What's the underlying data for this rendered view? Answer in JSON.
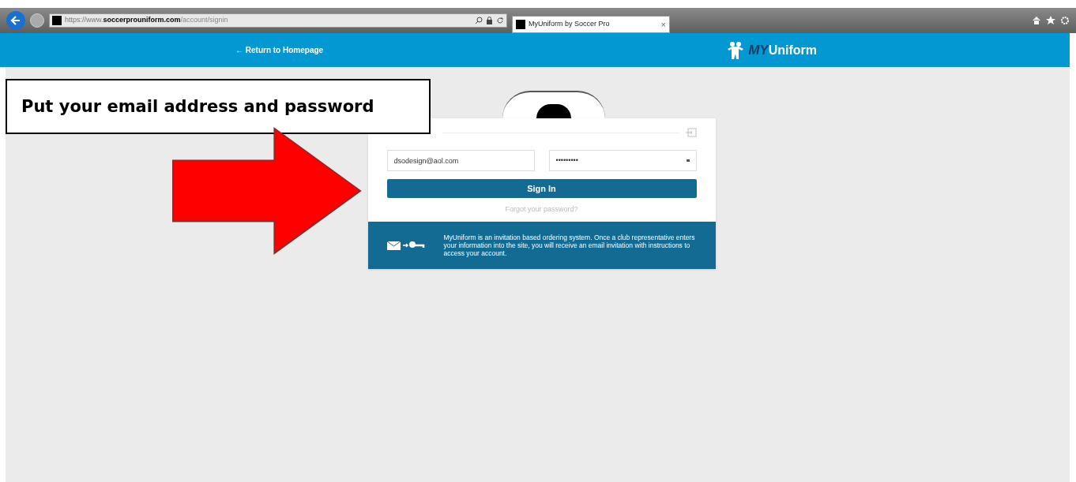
{
  "browser": {
    "url": {
      "scheme": "https://www.",
      "domain": "soccerprouniform.com",
      "path": "/account/signin"
    },
    "tab_title": "MyUniform by Soccer Pro",
    "tab_close": "×"
  },
  "header": {
    "back_link": "← Return to Homepage",
    "logo": {
      "prefix": "MY",
      "name": "Uniform"
    }
  },
  "callout": {
    "text": "Put your email address and password"
  },
  "signin": {
    "email": "dsodesign@aol.com",
    "password": "•••••••••",
    "button": "Sign In",
    "forgot": "Forgot your password?",
    "info": "MyUniform is an invitation based ordering system. Once a club representative enters your information into the site, you will receive an email invitation with instructions to access your account."
  }
}
